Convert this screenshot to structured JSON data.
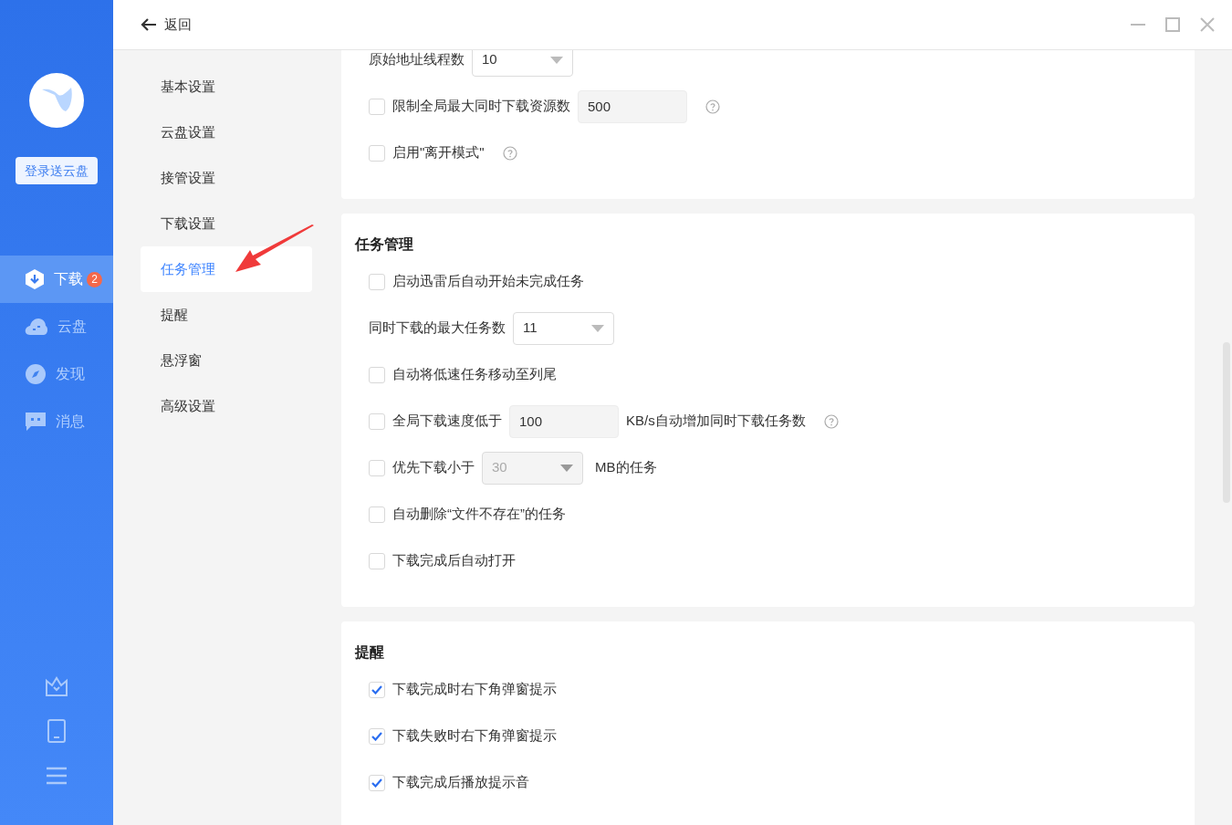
{
  "sidebar": {
    "login_button": "登录送云盘",
    "items": [
      {
        "kind": "download",
        "label": "下载",
        "badge": "2",
        "selected": true
      },
      {
        "kind": "cloud",
        "label": "云盘",
        "selected": false
      },
      {
        "kind": "discover",
        "label": "发现",
        "selected": false
      },
      {
        "kind": "message",
        "label": "消息",
        "selected": false
      }
    ],
    "bottom_icons": [
      {
        "kind": "crown"
      },
      {
        "kind": "phone"
      },
      {
        "kind": "menu"
      }
    ]
  },
  "header": {
    "back": "返回"
  },
  "settings_nav": [
    {
      "label": "基本设置",
      "selected": false
    },
    {
      "label": "云盘设置",
      "selected": false
    },
    {
      "label": "接管设置",
      "selected": false
    },
    {
      "label": "下载设置",
      "selected": false
    },
    {
      "label": "任务管理",
      "selected": true
    },
    {
      "label": "提醒",
      "selected": false
    },
    {
      "label": "悬浮窗",
      "selected": false
    },
    {
      "label": "高级设置",
      "selected": false
    }
  ],
  "sections": [
    {
      "rows": [
        {
          "kind": "select",
          "label": "原始地址线程数",
          "value": "10",
          "disabled": false
        },
        {
          "kind": "checkbox",
          "label": "限制全局最大同时下载资源数",
          "checked": false,
          "input": "500",
          "help": true
        },
        {
          "kind": "checkbox",
          "label": "启用\"离开模式\"",
          "checked": false,
          "help": true
        }
      ]
    },
    {
      "title": "任务管理",
      "rows": [
        {
          "kind": "checkbox",
          "label": "启动迅雷后自动开始未完成任务",
          "checked": false
        },
        {
          "kind": "select",
          "label": "同时下载的最大任务数",
          "value": "11",
          "disabled": false
        },
        {
          "kind": "checkbox",
          "label": "自动将低速任务移动至列尾",
          "checked": false
        },
        {
          "kind": "checkbox",
          "label": "全局下载速度低于",
          "checked": false,
          "input": "100",
          "suffix": "KB/s自动增加同时下载任务数",
          "help": true
        },
        {
          "kind": "checkbox",
          "label": "优先下载小于",
          "checked": false,
          "select": {
            "value": "30",
            "disabled": true
          },
          "suffix": "MB的任务"
        },
        {
          "kind": "checkbox",
          "label": "自动删除“文件不存在”的任务",
          "checked": false
        },
        {
          "kind": "checkbox",
          "label": "下载完成后自动打开",
          "checked": false
        }
      ]
    },
    {
      "title": "提醒",
      "rows": [
        {
          "kind": "checkbox",
          "label": "下载完成时右下角弹窗提示",
          "checked": true
        },
        {
          "kind": "checkbox",
          "label": "下载失败时右下角弹窗提示",
          "checked": true
        },
        {
          "kind": "checkbox",
          "label": "下载完成后播放提示音",
          "checked": true
        }
      ]
    }
  ]
}
